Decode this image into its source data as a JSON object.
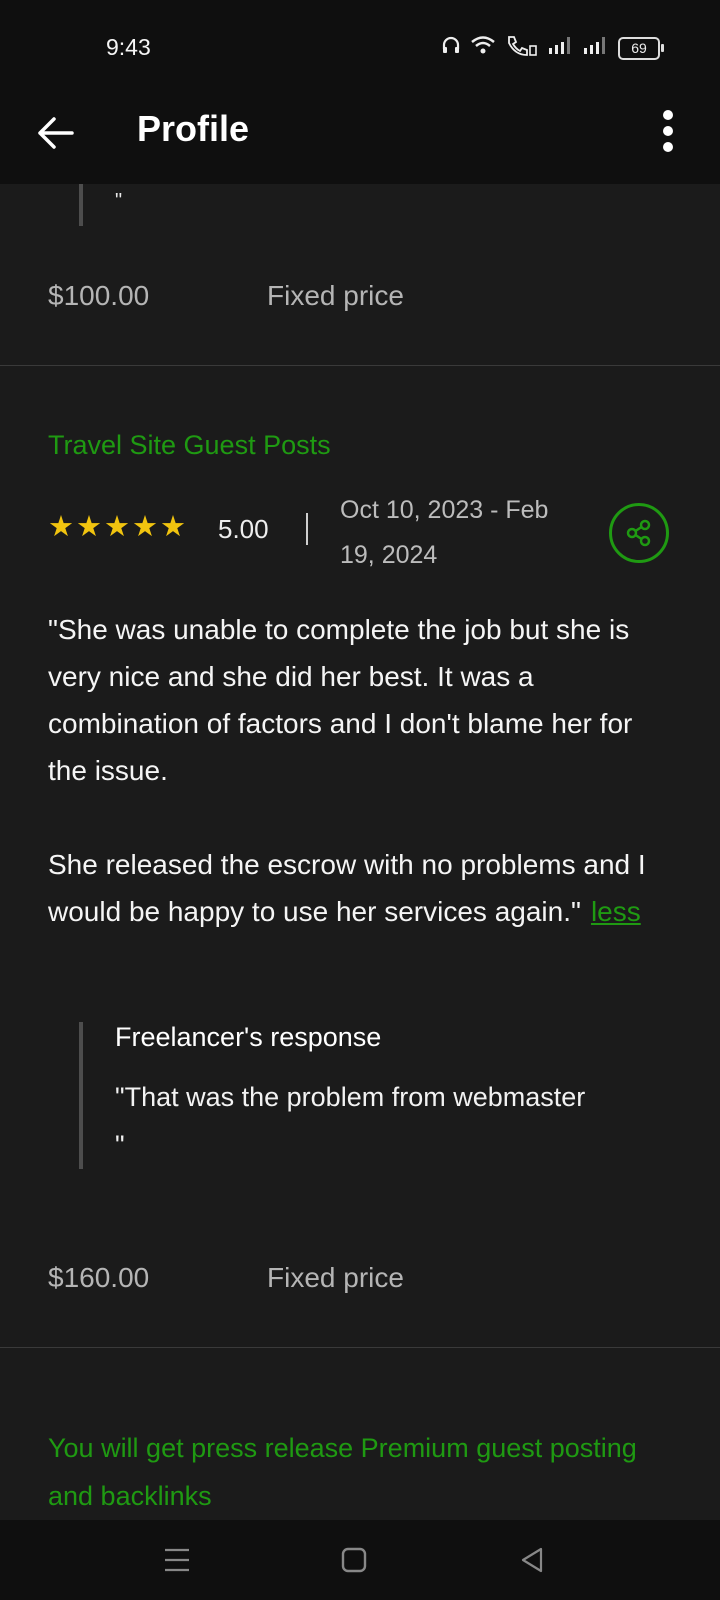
{
  "status": {
    "time": "9:43",
    "battery": "69"
  },
  "header": {
    "title": "Profile"
  },
  "prev_entry": {
    "stray_quote": "\"",
    "price": "$100.00",
    "price_type": "Fixed price"
  },
  "review": {
    "job_title": "Travel Site Guest Posts",
    "rating": "5.00",
    "stars": 5,
    "dates": "Oct 10, 2023 - Feb 19, 2024",
    "paragraph1": "\"She was unable to complete the job but she is very nice and she did her best. It was a combination of factors and I don't blame her for the issue.",
    "paragraph2": "She released the escrow with no problems and I would be happy to use her services again.\"",
    "less_link": "less",
    "response_title": "Freelancer's response",
    "response_text": "\"That was the problem from webmaster\n\"",
    "price": "$160.00",
    "price_type": "Fixed price"
  },
  "next_entry": {
    "job_title": "You will get press release Premium guest posting and backlinks"
  },
  "colors": {
    "accent": "#1f9a12",
    "star": "#f1c40f",
    "background": "#1b1b1b"
  }
}
